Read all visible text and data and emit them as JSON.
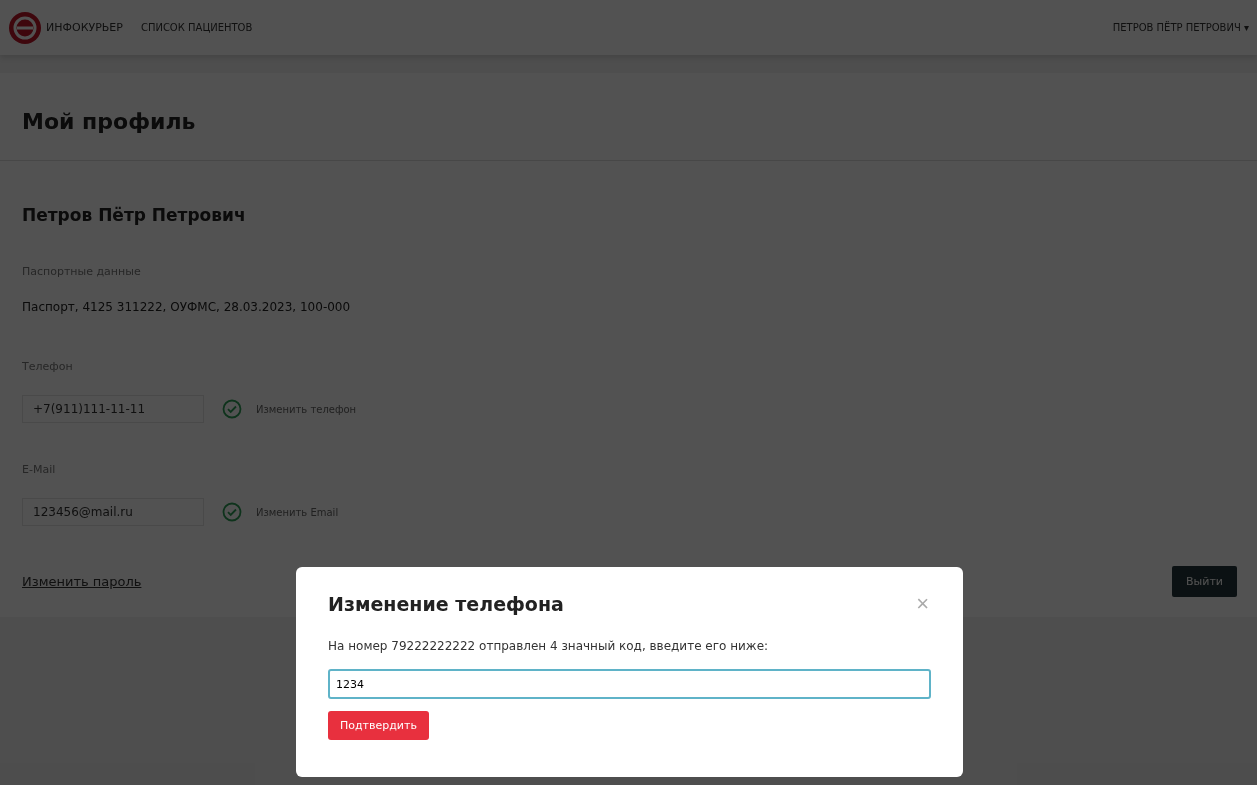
{
  "header": {
    "logo_text": "ИНФОКУРЬЕР",
    "nav": [
      {
        "label": "СПИСОК ПАЦИЕНТОВ",
        "selected": false
      }
    ],
    "user": "ПЕТРОВ ПЁТР ПЕТРОВИЧ",
    "user_caret": "▾"
  },
  "page_title": "Мой профиль",
  "profile": {
    "name": "Петров Пётр Петрович",
    "passport_label": "Паспортные данные",
    "passport": "Паспорт, 4125 311222, ОУФМС, 28.03.2023, 100-000",
    "contacts": [
      {
        "label": "Телефон",
        "value": "+7(911)111-11-11",
        "verified": true,
        "action": "Изменить телефон"
      },
      {
        "label": "E-Mail",
        "value": "123456@mail.ru",
        "verified": true,
        "action": "Изменить Email"
      }
    ],
    "password_link": "Изменить пароль",
    "exit_button": "Выйти"
  },
  "modal": {
    "title": "Изменение телефона",
    "close": "×",
    "message": "На номер 79222222222 отправлен 4 значный код, введите его ниже:",
    "code_value": "1234",
    "confirm_button": "Подтвердить"
  }
}
